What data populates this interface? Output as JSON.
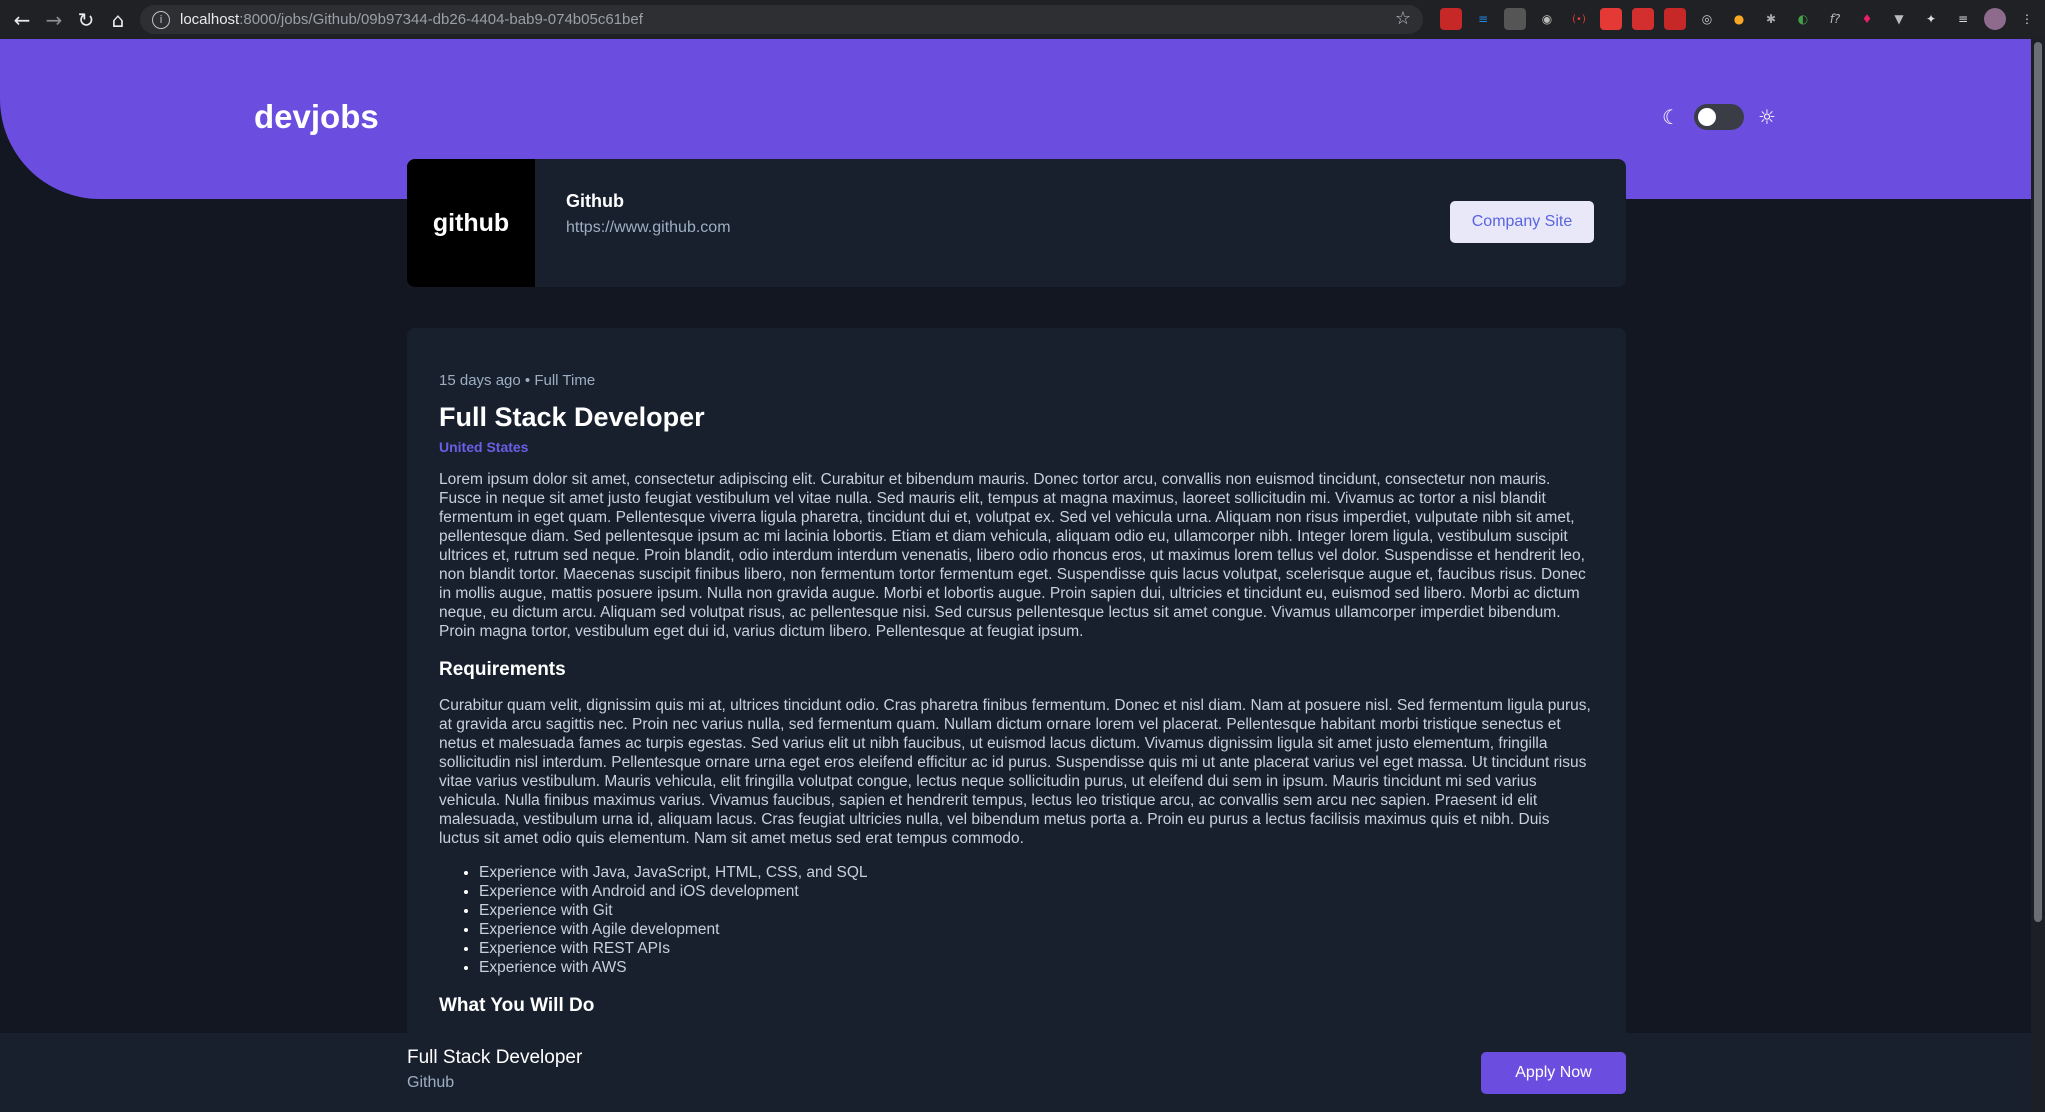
{
  "browser": {
    "url_host": "localhost",
    "url_path": ":8000/jobs/Github/09b97344-db26-4404-bab9-074b05c61bef"
  },
  "header": {
    "logo": "devjobs"
  },
  "company": {
    "logo_text": "github",
    "name": "Github",
    "website": "https://www.github.com",
    "site_button": "Company Site"
  },
  "job": {
    "posted": "15 days ago",
    "separator": "•",
    "contract": "Full Time",
    "title": "Full Stack Developer",
    "location": "United States",
    "description": "Lorem ipsum dolor sit amet, consectetur adipiscing elit. Curabitur et bibendum mauris. Donec tortor arcu, convallis non euismod tincidunt, consectetur non mauris. Fusce in neque sit amet justo feugiat vestibulum vel vitae nulla. Sed mauris elit, tempus at magna maximus, laoreet sollicitudin mi. Vivamus ac tortor a nisl blandit fermentum in eget quam. Pellentesque viverra ligula pharetra, tincidunt dui et, volutpat ex. Sed vel vehicula urna. Aliquam non risus imperdiet, vulputate nibh sit amet, pellentesque diam. Sed pellentesque ipsum ac mi lacinia lobortis. Etiam et diam vehicula, aliquam odio eu, ullamcorper nibh. Integer lorem ligula, vestibulum suscipit ultrices et, rutrum sed neque. Proin blandit, odio interdum interdum venenatis, libero odio rhoncus eros, ut maximus lorem tellus vel dolor. Suspendisse et hendrerit leo, non blandit tortor. Maecenas suscipit finibus libero, non fermentum tortor fermentum eget. Suspendisse quis lacus volutpat, scelerisque augue et, faucibus risus. Donec in mollis augue, mattis posuere ipsum. Nulla non gravida augue. Morbi et lobortis augue. Proin sapien dui, ultricies et tincidunt eu, euismod sed libero. Morbi ac dictum neque, eu dictum arcu. Aliquam sed volutpat risus, ac pellentesque nisi. Sed cursus pellentesque lectus sit amet congue. Vivamus ullamcorper imperdiet bibendum. Proin magna tortor, vestibulum eget dui id, varius dictum libero. Pellentesque at feugiat ipsum.",
    "requirements_title": "Requirements",
    "requirements_text": "Curabitur quam velit, dignissim quis mi at, ultrices tincidunt odio. Cras pharetra finibus fermentum. Donec et nisl diam. Nam at posuere nisl. Sed fermentum ligula purus, at gravida arcu sagittis nec. Proin nec varius nulla, sed fermentum quam. Nullam dictum ornare lorem vel placerat. Pellentesque habitant morbi tristique senectus et netus et malesuada fames ac turpis egestas. Sed varius elit ut nibh faucibus, ut euismod lacus dictum. Vivamus dignissim ligula sit amet justo elementum, fringilla sollicitudin nisl interdum. Pellentesque ornare urna eget eros eleifend efficitur ac id purus. Suspendisse quis mi ut ante placerat varius vel eget massa. Ut tincidunt risus vitae varius vestibulum. Mauris vehicula, elit fringilla volutpat congue, lectus neque sollicitudin purus, ut eleifend dui sem in ipsum. Mauris tincidunt mi sed varius vehicula. Nulla finibus maximus varius. Vivamus faucibus, sapien et hendrerit tempus, lectus leo tristique arcu, ac convallis sem arcu nec sapien. Praesent id elit malesuada, vestibulum urna id, aliquam lacus. Cras feugiat ultricies nulla, vel bibendum metus porta a. Proin eu purus a lectus facilisis maximus quis et nibh. Duis luctus sit amet odio quis elementum. Nam sit amet metus sed erat tempus commodo.",
    "requirements": [
      "Experience with Java, JavaScript, HTML, CSS, and SQL",
      "Experience with Android and iOS development",
      "Experience with Git",
      "Experience with Agile development",
      "Experience with REST APIs",
      "Experience with AWS"
    ],
    "role_title": "What You Will Do"
  },
  "footer": {
    "title": "Full Stack Developer",
    "company": "Github",
    "apply_button": "Apply Now"
  },
  "colors": {
    "brand": "#6b4ee0",
    "background": "#121721",
    "card": "#19202d"
  }
}
